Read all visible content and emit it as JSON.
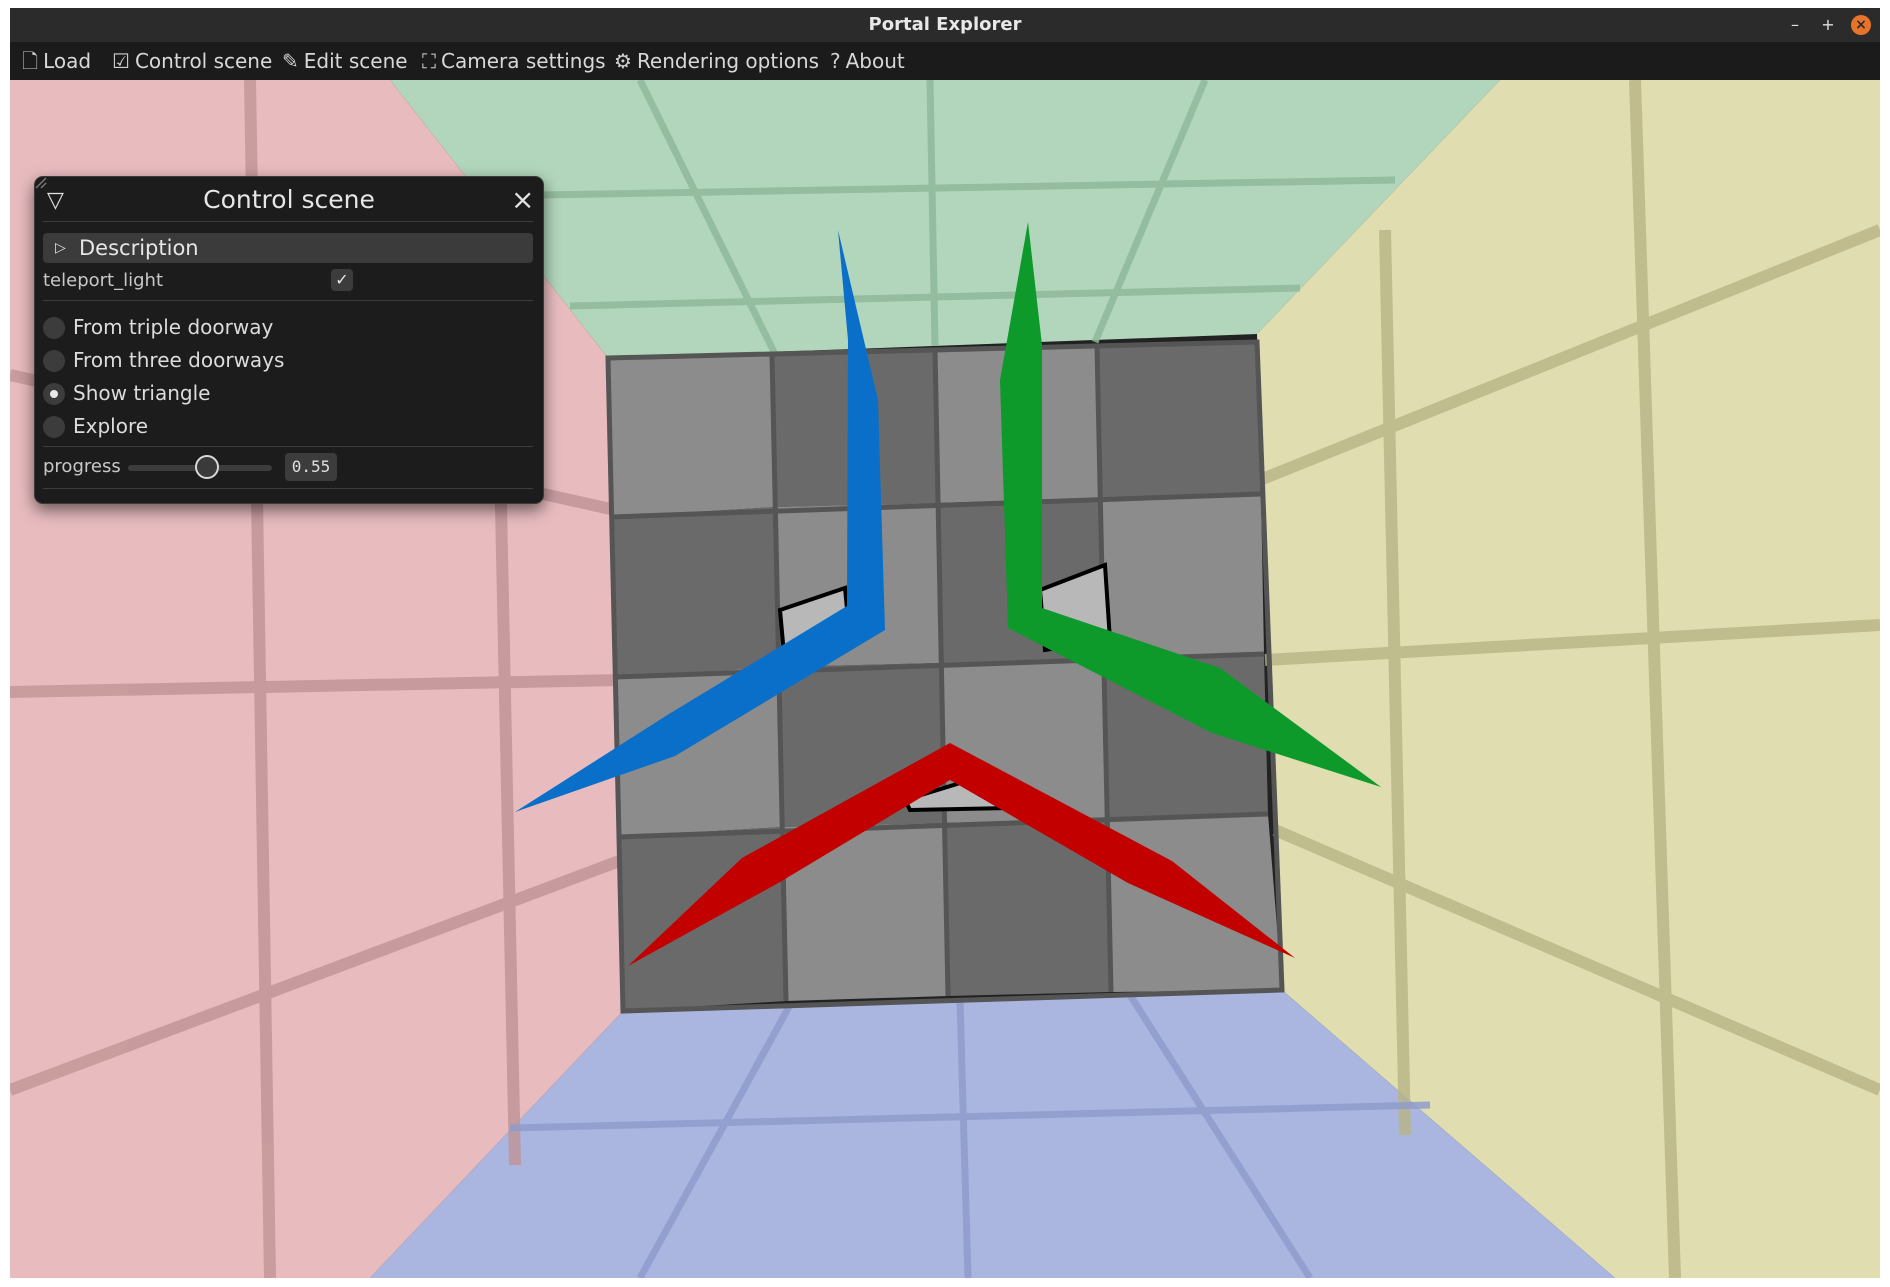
{
  "window": {
    "title": "Portal Explorer",
    "controls": {
      "minimize": "–",
      "maximize": "+",
      "close": "×"
    }
  },
  "menu": [
    {
      "label": "Load",
      "icon": "file-icon"
    },
    {
      "label": "Control scene",
      "icon": "checkbox-icon"
    },
    {
      "label": "Edit scene",
      "icon": "pencil-icon"
    },
    {
      "label": "Camera settings",
      "icon": "camera-icon"
    },
    {
      "label": "Rendering options",
      "icon": "gear-icon"
    },
    {
      "label": "About",
      "icon": "question-icon"
    }
  ],
  "panel": {
    "title": "Control scene",
    "description_label": "Description",
    "teleport_light": {
      "label": "teleport_light",
      "checked": true
    },
    "options": [
      {
        "label": "From triple doorway",
        "selected": false
      },
      {
        "label": "From three doorways",
        "selected": false
      },
      {
        "label": "Show triangle",
        "selected": true
      },
      {
        "label": "Explore",
        "selected": false
      }
    ],
    "progress": {
      "label": "progress",
      "value": 0.55,
      "display": "0.55"
    }
  },
  "scene": {
    "colors": {
      "ceiling": "#b2d6bc",
      "left_wall": "#e8bcbf",
      "right_wall": "#e0ddb0",
      "floor": "#aab6e0",
      "back_wall_light": "#8c8c8c",
      "back_wall_dark": "#6a6a6a",
      "arm_blue": "#0a6fc8",
      "arm_green": "#0d9a2a",
      "arm_red": "#c20000"
    }
  }
}
